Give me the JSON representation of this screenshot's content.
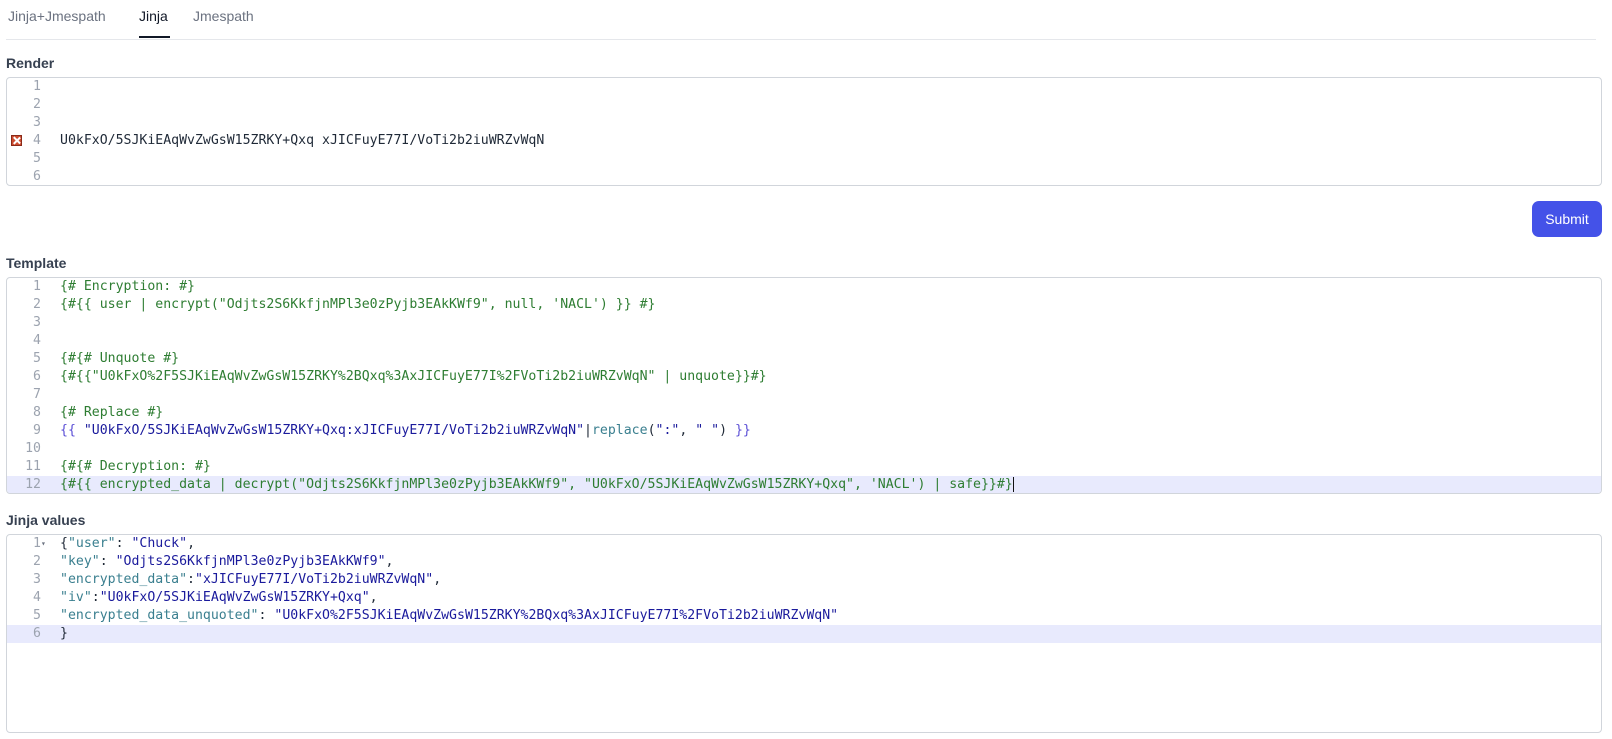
{
  "tabs": [
    {
      "label": "Jinja+Jmespath"
    },
    {
      "label": "Jinja"
    },
    {
      "label": "Jmespath"
    }
  ],
  "active_tab": "Jinja",
  "render": {
    "label": "Render",
    "lines": [
      {
        "n": "1",
        "text": ""
      },
      {
        "n": "2",
        "text": ""
      },
      {
        "n": "3",
        "text": ""
      },
      {
        "n": "4",
        "text": "U0kFxO/5SJKiEAqWvZwGsW15ZRKY+Qxq xJICFuyE77I/VoTi2b2iuWRZvWqN",
        "error": true
      },
      {
        "n": "5",
        "text": ""
      },
      {
        "n": "6",
        "text": ""
      }
    ]
  },
  "submit_label": "Submit",
  "template": {
    "label": "Template",
    "lines": [
      {
        "n": "1",
        "parts": [
          {
            "t": "{# Encryption: #}",
            "c": "comment"
          }
        ]
      },
      {
        "n": "2",
        "parts": [
          {
            "t": "{#{{ user | encrypt(\"Odjts2S6KkfjnMPl3e0zPyjb3EAkKWf9\", null, 'NACL') }} #}",
            "c": "comment"
          }
        ]
      },
      {
        "n": "3",
        "parts": []
      },
      {
        "n": "4",
        "parts": []
      },
      {
        "n": "5",
        "parts": [
          {
            "t": "{#{# Unquote #}",
            "c": "comment"
          }
        ]
      },
      {
        "n": "6",
        "parts": [
          {
            "t": "{#{{\"U0kFxO%2F5SJKiEAqWvZwGsW15ZRKY%2BQxq%3AxJICFuyE77I%2FVoTi2b2iuWRZvWqN\" | unquote}}#}",
            "c": "comment"
          }
        ]
      },
      {
        "n": "7",
        "parts": []
      },
      {
        "n": "8",
        "parts": [
          {
            "t": "{# Replace #}",
            "c": "comment"
          }
        ]
      },
      {
        "n": "9",
        "parts": [
          {
            "t": "{{ ",
            "c": "delim"
          },
          {
            "t": "\"U0kFxO/5SJKiEAqWvZwGsW15ZRKY+Qxq:xJICFuyE77I/VoTi2b2iuWRZvWqN\"",
            "c": "string"
          },
          {
            "t": "|",
            "c": "plain"
          },
          {
            "t": "replace",
            "c": "filter"
          },
          {
            "t": "(",
            "c": "plain"
          },
          {
            "t": "\":\"",
            "c": "string"
          },
          {
            "t": ", ",
            "c": "plain"
          },
          {
            "t": "\" \"",
            "c": "string"
          },
          {
            "t": ") ",
            "c": "plain"
          },
          {
            "t": "}}",
            "c": "delim"
          }
        ]
      },
      {
        "n": "10",
        "parts": []
      },
      {
        "n": "11",
        "parts": [
          {
            "t": "{#{# Decryption: #}",
            "c": "comment"
          }
        ]
      },
      {
        "n": "12",
        "active": true,
        "parts": [
          {
            "t": "{#{{ encrypted_data | decrypt(\"Odjts2S6KkfjnMPl3e0zPyjb3EAkKWf9\", \"U0kFxO/5SJKiEAqWvZwGsW15ZRKY+Qxq\", 'NACL') | safe}}#}",
            "c": "comment"
          }
        ]
      }
    ]
  },
  "values": {
    "label": "Jinja values",
    "lines": [
      {
        "n": "1",
        "fold": true,
        "parts": [
          {
            "t": "{",
            "c": "plain"
          },
          {
            "t": "\"user\"",
            "c": "key"
          },
          {
            "t": ": ",
            "c": "plain"
          },
          {
            "t": "\"Chuck\"",
            "c": "str"
          },
          {
            "t": ",",
            "c": "plain"
          }
        ]
      },
      {
        "n": "2",
        "parts": [
          {
            "t": "\"key\"",
            "c": "key"
          },
          {
            "t": ": ",
            "c": "plain"
          },
          {
            "t": "\"Odjts2S6KkfjnMPl3e0zPyjb3EAkKWf9\"",
            "c": "str"
          },
          {
            "t": ",",
            "c": "plain"
          }
        ]
      },
      {
        "n": "3",
        "parts": [
          {
            "t": "\"encrypted_data\"",
            "c": "key"
          },
          {
            "t": ":",
            "c": "plain"
          },
          {
            "t": "\"xJICFuyE77I/VoTi2b2iuWRZvWqN\"",
            "c": "str"
          },
          {
            "t": ",",
            "c": "plain"
          }
        ]
      },
      {
        "n": "4",
        "parts": [
          {
            "t": "\"iv\"",
            "c": "key"
          },
          {
            "t": ":",
            "c": "plain"
          },
          {
            "t": "\"U0kFxO/5SJKiEAqWvZwGsW15ZRKY+Qxq\"",
            "c": "str"
          },
          {
            "t": ",",
            "c": "plain"
          }
        ]
      },
      {
        "n": "5",
        "parts": [
          {
            "t": "\"encrypted_data_unquoted\"",
            "c": "key"
          },
          {
            "t": ": ",
            "c": "plain"
          },
          {
            "t": "\"U0kFxO%2F5SJKiEAqWvZwGsW15ZRKY%2BQxq%3AxJICFuyE77I%2FVoTi2b2iuWRZvWqN\"",
            "c": "str"
          }
        ]
      },
      {
        "n": "6",
        "active": true,
        "parts": [
          {
            "t": "}",
            "c": "plain"
          }
        ]
      }
    ]
  },
  "colors": {
    "accent": "#4452e8",
    "comment": "#2e7d32",
    "string": "#1a1a9c",
    "active_line": "#e8eafd",
    "error": "#cc4b2f"
  },
  "icons": {
    "error": "error-marker-icon",
    "fold": "fold-arrow-icon"
  }
}
